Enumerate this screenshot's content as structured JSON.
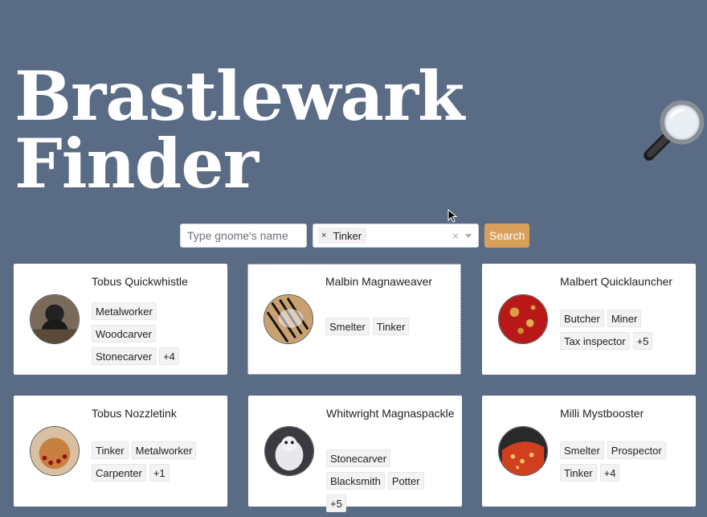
{
  "header": {
    "title": "Brastlewark Finder",
    "title_icon": "magnifying-glass-icon"
  },
  "search": {
    "placeholder": "Type gnome's name",
    "value": "",
    "selected_profession": "Tinker",
    "chip_remove": "×",
    "clear": "×",
    "button_label": "Search"
  },
  "gnomes": [
    {
      "name": "Tobus Quickwhistle",
      "tags": [
        "Metalworker",
        "Woodcarver",
        "Stonecarver",
        "+4"
      ]
    },
    {
      "name": "Malbin Magnaweaver",
      "tags": [
        "Smelter",
        "Tinker"
      ]
    },
    {
      "name": "Malbert Quicklauncher",
      "tags": [
        "Butcher",
        "Miner",
        "Tax inspector",
        "+5"
      ]
    },
    {
      "name": "Tobus Nozzletink",
      "tags": [
        "Tinker",
        "Metalworker",
        "Carpenter",
        "+1"
      ]
    },
    {
      "name": "Whitwright Magnaspackle",
      "tags": [
        "Stonecarver",
        "Blacksmith",
        "Potter",
        "+5"
      ]
    },
    {
      "name": "Milli Mystbooster",
      "tags": [
        "Smelter",
        "Prospector",
        "Tinker",
        "+4"
      ]
    }
  ],
  "colors": {
    "background": "#5a6b85",
    "button": "#d9a05b",
    "card": "#ffffff"
  }
}
